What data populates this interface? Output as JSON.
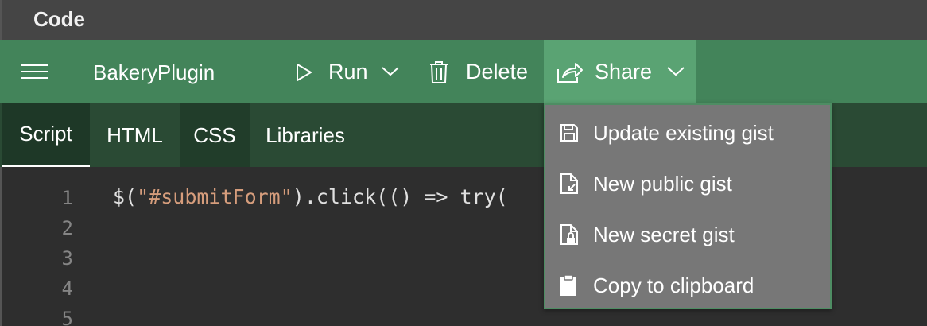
{
  "window": {
    "title": "Code"
  },
  "toolbar": {
    "project_name": "BakeryPlugin",
    "run_label": "Run",
    "delete_label": "Delete",
    "share_label": "Share"
  },
  "tabs": [
    {
      "label": "Script",
      "active": true
    },
    {
      "label": "HTML",
      "active": false
    },
    {
      "label": "CSS",
      "active": false
    },
    {
      "label": "Libraries",
      "active": false
    }
  ],
  "editor": {
    "line_numbers": [
      "1",
      "2",
      "3",
      "4",
      "5"
    ],
    "line1": {
      "prefix": "$(",
      "string": "\"#submitForm\"",
      "suffix": ").click(() => try("
    }
  },
  "share_menu": {
    "items": [
      {
        "label": "Update existing gist",
        "icon": "save-icon"
      },
      {
        "label": "New public gist",
        "icon": "public-document-icon"
      },
      {
        "label": "New secret gist",
        "icon": "lock-document-icon"
      },
      {
        "label": "Copy to clipboard",
        "icon": "clipboard-icon"
      }
    ]
  },
  "colors": {
    "toolbar": "#43845a",
    "share_active": "#5aa373",
    "tabbar": "#2a4a34",
    "menu_bg": "#777777",
    "string": "#d69d7c"
  }
}
